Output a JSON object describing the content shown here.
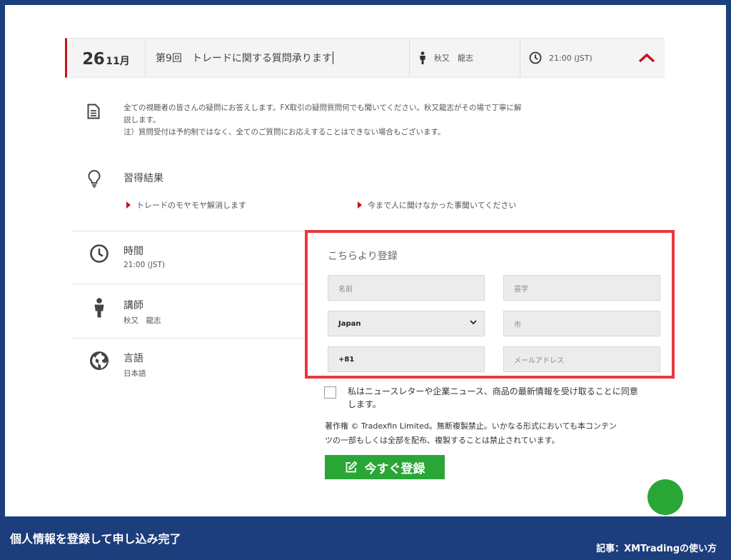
{
  "header": {
    "date_day": "26",
    "date_month": "11月",
    "title": "第9回　トレードに関する質問承ります",
    "instructor": "秋又　龍志",
    "time": "21:00 (JST)",
    "collapse_icon": "chevron-up-icon"
  },
  "description": {
    "icon": "document-icon",
    "line1": "全ての視聴者の皆さんの疑問にお答えします。FX取引の疑問質問何でも聞いてください。秋又龍志がその場で丁寧に解",
    "line2": "説します。",
    "line3": "注）質問受付は予約制ではなく、全てのご質問にお応えすることはできない場合もございます。"
  },
  "outcomes": {
    "icon": "lightbulb-icon",
    "title": "習得結果",
    "items": [
      "トレードのモヤモヤ解消します",
      "今まで人に聞けなかった事聞いてください"
    ]
  },
  "info": {
    "time_label": "時間",
    "time_value": "21:00 (JST)",
    "instructor_label": "講師",
    "instructor_value": "秋又　龍志",
    "language_label": "言語",
    "language_value": "日本語"
  },
  "form": {
    "title": "こちらより登録",
    "first_name_placeholder": "名前",
    "last_name_placeholder": "苗字",
    "country_value": "Japan",
    "city_placeholder": "市",
    "phone_value": "+81",
    "email_placeholder": "メールアドレス",
    "highlight_color": "#e8383d"
  },
  "consent": {
    "text_line1": "私はニュースレターや企業ニュース、商品の最新情報を受け取ることに同意",
    "text_line2": "します。",
    "checked": false
  },
  "copyright": {
    "line1": "著作権 © Tradexfin Limited。無断複製禁止。いかなる形式においても本コンテン",
    "line2": "ツの一部もしくは全部を配布、複製することは禁止されています。"
  },
  "register_button": {
    "label": "今すぐ登録",
    "icon": "edit-icon",
    "color": "#2aa637"
  },
  "caption": {
    "left": "個人情報を登録して申し込み完了",
    "right": "記事：XMTradingの使い方",
    "background": "#1d3e7c"
  }
}
